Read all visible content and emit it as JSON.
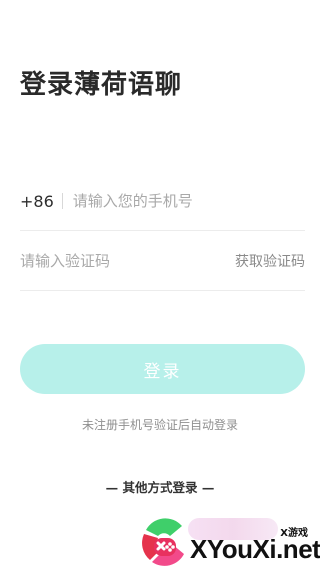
{
  "header": {
    "title": "登录薄荷语聊"
  },
  "phone_field": {
    "country_code": "+86",
    "placeholder": "请输入您的手机号",
    "value": ""
  },
  "code_field": {
    "placeholder": "请输入验证码",
    "value": "",
    "get_code_label": "获取验证码"
  },
  "login_button": {
    "label": "登录",
    "color": "#b7f0ea"
  },
  "hint_text": "未注册手机号验证后自动登录",
  "other_login_label": "— 其他方式登录 —",
  "watermark": {
    "small_text": "X游戏",
    "big_text": "XYouXi.net"
  }
}
